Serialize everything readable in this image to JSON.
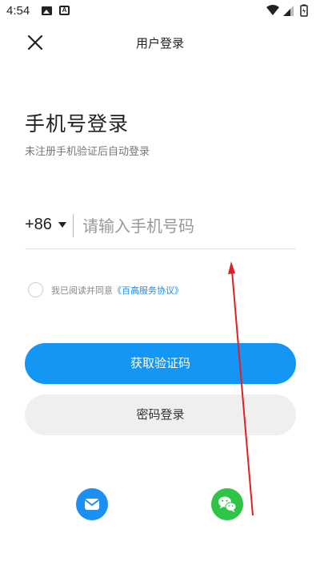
{
  "status_bar": {
    "time": "4:54",
    "icons": [
      "image-icon",
      "a-notification-icon",
      "wifi-icon",
      "signal-icon",
      "battery-icon"
    ]
  },
  "header": {
    "title": "用户登录",
    "close_icon": "close-icon"
  },
  "main": {
    "title": "手机号登录",
    "subtitle": "未注册手机验证后自动登录",
    "phone": {
      "country_code": "+86",
      "placeholder": "请输入手机号码",
      "value": ""
    },
    "agreement": {
      "prefix": "我已阅读并同意",
      "link": "《百高服务协议》",
      "checked": false
    },
    "primary_button": "获取验证码",
    "secondary_button": "密码登录"
  },
  "social_login": [
    {
      "icon": "email-icon",
      "color": "#1b8ff2"
    },
    {
      "icon": "wechat-icon",
      "color": "#2ec445"
    }
  ],
  "colors": {
    "accent": "#1496f5",
    "link": "#1a8cf0",
    "annotation": "#e02020"
  }
}
